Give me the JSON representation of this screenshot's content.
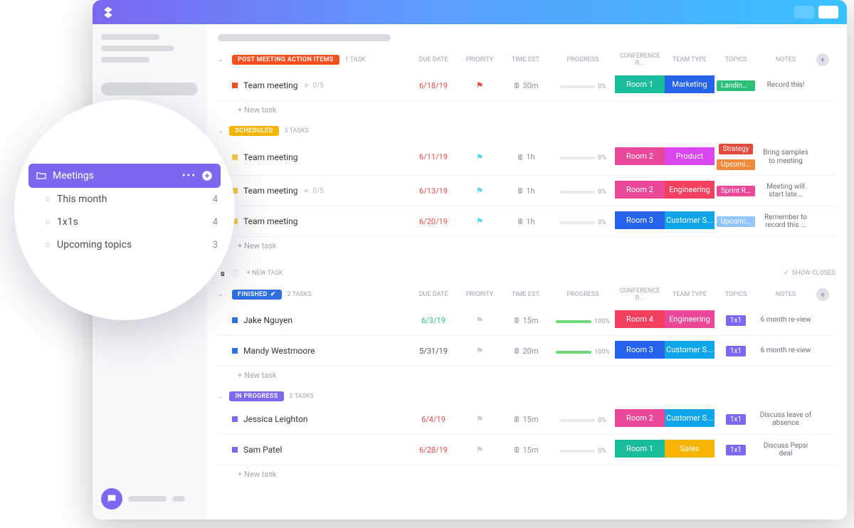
{
  "columns": {
    "due_date": "DUE DATE",
    "priority": "PRIORITY",
    "time_est": "TIME EST.",
    "progress": "PROGRESS",
    "conference": "CONFERENCE R...",
    "team_type": "TEAM TYPE",
    "topics": "TOPICS",
    "notes": "NOTES"
  },
  "showClosed": "SHOW CLOSED",
  "newTask": "+ New task",
  "newTaskUpper": "+ NEW TASK",
  "popup": {
    "title": "Meetings",
    "items": [
      {
        "label": "This month",
        "count": "4"
      },
      {
        "label": "1x1s",
        "count": "4"
      },
      {
        "label": "Upcoming topics",
        "count": "3"
      }
    ]
  },
  "lists": [
    {
      "status": {
        "label": "POST MEETING ACTION ITEMS",
        "color": "#f4511e",
        "marker": "#f4511e"
      },
      "count": "1 TASK",
      "showHeader": true,
      "tasks": [
        {
          "name": "Team meeting",
          "subtasks": "0/5",
          "due": "6/18/19",
          "dueCls": "red",
          "flagCls": "red",
          "time": "30m",
          "progress": 0,
          "progText": "0%",
          "room": {
            "t": "Room 1",
            "c": "#1abc9c"
          },
          "team": {
            "t": "Marketing",
            "c": "#2563eb"
          },
          "topics": [
            {
              "t": "Landing...",
              "c": "#2bbf7a"
            }
          ],
          "notes": "Record this!"
        }
      ]
    },
    {
      "status": {
        "label": "SCHEDULED",
        "color": "#f7b500",
        "marker": "#f7c948"
      },
      "count": "3 TASKS",
      "showHeader": false,
      "tasks": [
        {
          "name": "Team meeting",
          "due": "6/11/19",
          "dueCls": "red",
          "flagCls": "cyan",
          "time": "1h",
          "progress": 0,
          "progText": "0%",
          "room": {
            "t": "Room 2",
            "c": "#ec4899"
          },
          "team": {
            "t": "Product",
            "c": "#d946ef"
          },
          "topics": [
            {
              "t": "Strategy",
              "c": "#e24b3b"
            },
            {
              "t": "Upcomi...",
              "c": "#f08a3a"
            }
          ],
          "notes": "Bring samples to meeting"
        },
        {
          "name": "Team meeting",
          "subtasks": "0/5",
          "due": "6/13/19",
          "dueCls": "red",
          "flagCls": "cyan",
          "time": "1h",
          "progress": 0,
          "progText": "0%",
          "room": {
            "t": "Room 2",
            "c": "#ec4899"
          },
          "team": {
            "t": "Engineering",
            "c": "#f43f5e"
          },
          "topics": [
            {
              "t": "Sprint R...",
              "c": "#ec4899"
            }
          ],
          "notes": "Meeting will start late..."
        },
        {
          "name": "Team meeting",
          "due": "6/20/19",
          "dueCls": "red",
          "flagCls": "cyan",
          "time": "1h",
          "progress": 0,
          "progText": "0%",
          "room": {
            "t": "Room 3",
            "c": "#2563eb"
          },
          "team": {
            "t": "Customer S...",
            "c": "#0ea5e9"
          },
          "topics": [
            {
              "t": "Upcomi...",
              "c": "#93c5fd"
            }
          ],
          "notes": "Remember to record this ..."
        }
      ]
    }
  ],
  "sectionLabel": "s",
  "lists2": [
    {
      "status": {
        "label": "FINISHED",
        "color": "#2f6fe0",
        "marker": "#2f6fe0",
        "check": true
      },
      "count": "2 TASKS",
      "showHeader": true,
      "tasks": [
        {
          "name": "Jake Nguyen",
          "due": "6/3/19",
          "dueCls": "green",
          "flagCls": "grey",
          "time": "15m",
          "progress": 100,
          "progText": "100%",
          "room": {
            "t": "Room 4",
            "c": "#f43f5e"
          },
          "team": {
            "t": "Engineering",
            "c": "#ec4899"
          },
          "topics": [
            {
              "t": "1x1",
              "c": "#7b68ee"
            }
          ],
          "notes": "6 month re-view"
        },
        {
          "name": "Mandy Westmoore",
          "due": "5/31/19",
          "dueCls": "",
          "flagCls": "grey",
          "time": "20m",
          "progress": 100,
          "progText": "100%",
          "room": {
            "t": "Room 3",
            "c": "#2563eb"
          },
          "team": {
            "t": "Customer S...",
            "c": "#0ea5e9"
          },
          "topics": [
            {
              "t": "1x1",
              "c": "#7b68ee"
            }
          ],
          "notes": "6 month re-view"
        }
      ]
    },
    {
      "status": {
        "label": "IN PROGRESS",
        "color": "#7b68ee",
        "marker": "#7b68ee"
      },
      "count": "2 TASKS",
      "showHeader": false,
      "tasks": [
        {
          "name": "Jessica Leighton",
          "due": "6/4/19",
          "dueCls": "red",
          "flagCls": "grey",
          "time": "15m",
          "progress": 0,
          "progText": "0%",
          "room": {
            "t": "Room 2",
            "c": "#ec4899"
          },
          "team": {
            "t": "Customer S...",
            "c": "#0ea5e9"
          },
          "topics": [
            {
              "t": "1x1",
              "c": "#7b68ee"
            }
          ],
          "notes": "Discuss leave of absence"
        },
        {
          "name": "Sam Patel",
          "due": "6/28/19",
          "dueCls": "red",
          "flagCls": "grey",
          "time": "15m",
          "progress": 0,
          "progText": "0%",
          "room": {
            "t": "Room 1",
            "c": "#1abc9c"
          },
          "team": {
            "t": "Sales",
            "c": "#f7b500"
          },
          "topics": [
            {
              "t": "1x1",
              "c": "#7b68ee"
            }
          ],
          "notes": "Discuss Pepsi deal"
        }
      ]
    }
  ]
}
